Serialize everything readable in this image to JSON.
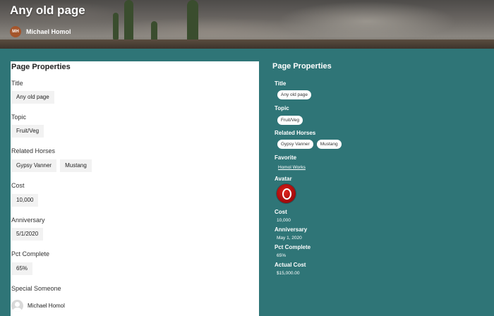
{
  "header": {
    "title": "Any old page",
    "author_initials": "MH",
    "author_name": "Michael Homol"
  },
  "left_panel": {
    "title": "Page Properties",
    "fields": {
      "title": {
        "label": "Title",
        "value": "Any old page"
      },
      "topic": {
        "label": "Topic",
        "value": "Fruit/Veg"
      },
      "related_horses": {
        "label": "Related Horses",
        "values": [
          "Gypsy Vanner",
          "Mustang"
        ]
      },
      "cost": {
        "label": "Cost",
        "value": "10,000"
      },
      "anniversary": {
        "label": "Anniversary",
        "value": "5/1/2020"
      },
      "pct_complete": {
        "label": "Pct Complete",
        "value": "65%"
      },
      "special_someone": {
        "label": "Special Someone",
        "value": "Michael Homol"
      }
    }
  },
  "right_panel": {
    "title": "Page Properties",
    "title_field": {
      "label": "Title",
      "value": "Any old page"
    },
    "topic": {
      "label": "Topic",
      "value": "Fruit/Veg"
    },
    "related_horses": {
      "label": "Related Horses",
      "values": [
        "Gypsy Vanner",
        "Mustang"
      ]
    },
    "favorite": {
      "label": "Favorite",
      "value": "Homol Works"
    },
    "avatar": {
      "label": "Avatar"
    },
    "cost": {
      "label": "Cost",
      "value": "10,000"
    },
    "anniversary": {
      "label": "Anniversary",
      "value": "May 1, 2020"
    },
    "pct_complete": {
      "label": "Pct Complete",
      "value": "65%"
    },
    "actual_cost": {
      "label": "Actual Cost",
      "value": "$15,000.00"
    }
  },
  "colors": {
    "page_background": "#2f7577",
    "author_avatar": "#a4552b",
    "avatar_red": "#c8161a"
  }
}
